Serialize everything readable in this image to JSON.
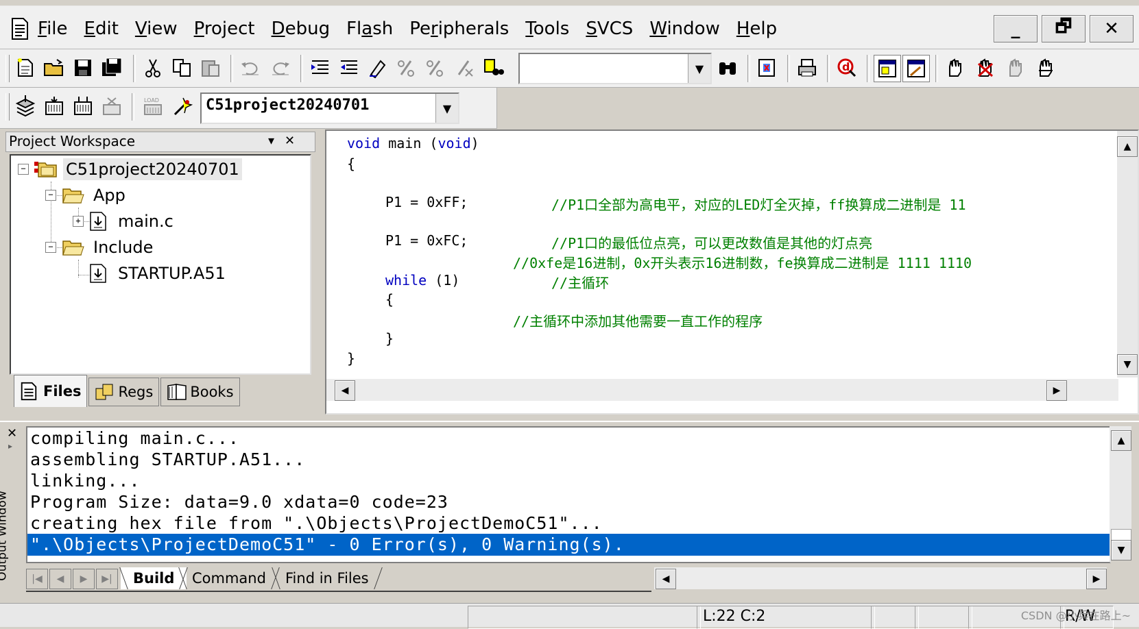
{
  "menubar": {
    "items": [
      {
        "key": "F",
        "rest": "ile"
      },
      {
        "key": "E",
        "rest": "dit"
      },
      {
        "key": "V",
        "rest": "iew"
      },
      {
        "key": "P",
        "rest": "roject"
      },
      {
        "key": "D",
        "rest": "ebug"
      },
      {
        "pre": "Fl",
        "key": "a",
        "rest": "sh"
      },
      {
        "pre": "Pe",
        "key": "r",
        "rest": "ipherals"
      },
      {
        "key": "T",
        "rest": "ools"
      },
      {
        "key": "S",
        "rest": "VCS"
      },
      {
        "key": "W",
        "rest": "indow"
      },
      {
        "key": "H",
        "rest": "elp"
      }
    ],
    "minimize": "_",
    "restore": "🗗",
    "close": "✕"
  },
  "toolbar2": {
    "target_value": "C51project20240701"
  },
  "workspace": {
    "title": "Project Workspace",
    "pin": "▾",
    "close": "✕",
    "tree": {
      "project": "C51project20240701",
      "group1": "App",
      "file1": "main.c",
      "group2": "Include",
      "file2": "STARTUP.A51"
    },
    "tabs": {
      "files": "Files",
      "regs": "Regs",
      "books": "Books"
    }
  },
  "editor": {
    "l1_kw1": "void",
    "l1_mid": " main (",
    "l1_kw2": "void",
    "l1_end": ")",
    "l2": "{",
    "l3_code": "P1 = 0xFF;",
    "l3_cm": "//P1口全部为高电平，对应的LED灯全灭掉，ff换算成二进制是 11",
    "l4_code": "P1 = 0xFC;",
    "l4_cm": "//P1口的最低位点亮，可以更改数值是其他的灯点亮",
    "l5_cm": "//0xfe是16进制，0x开头表示16进制数，fe换算成二进制是 1111 1110",
    "l6_kw": "while",
    "l6_code": " (1)",
    "l6_cm": "//主循环",
    "l7": "{",
    "l8_cm": "//主循环中添加其他需要一直工作的程序",
    "l9": "}",
    "l10": "}"
  },
  "output": {
    "side_title": "Output Window",
    "lines": [
      "compiling main.c...",
      "assembling STARTUP.A51...",
      "linking...",
      "Program Size: data=9.0 xdata=0 code=23",
      "creating hex file from \".\\Objects\\ProjectDemoC51\"...",
      "\".\\Objects\\ProjectDemoC51\" - 0 Error(s), 0 Warning(s)."
    ],
    "tabs": {
      "build": "Build",
      "command": "Command",
      "find": "Find in Files"
    }
  },
  "status": {
    "position": "L:22 C:2",
    "rw": "R/W",
    "watermark": "CSDN @小兵在路上~"
  },
  "colors": {
    "keyword": "#0000c0",
    "comment": "#008000",
    "selection": "#0064c8"
  }
}
